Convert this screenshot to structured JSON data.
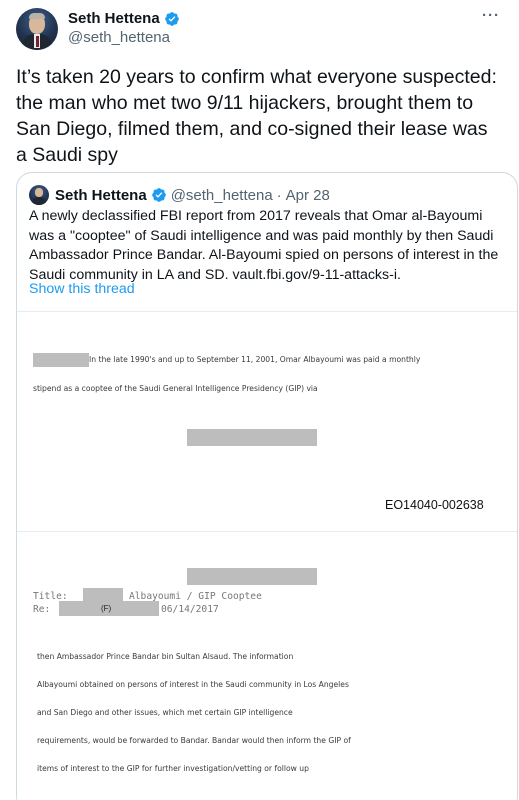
{
  "author": {
    "name": "Seth Hettena",
    "handle": "@seth_hettena"
  },
  "more_label": "···",
  "tweet_text": "It’s taken 20 years to confirm what everyone suspected: the man who met two 9/11 hijackers, brought them to San Diego, filmed them, and co-signed their lease was a Saudi spy",
  "quote": {
    "name": "Seth Hettena",
    "handle": "@seth_hettena",
    "dot": "·",
    "date": "Apr 28",
    "text": "A newly declassified FBI report from 2017 reveals that Omar al-Bayoumi was a \"cooptee\" of Saudi intelligence and was paid monthly by then Saudi Ambassador Prince Bandar. Al-Bayoumi spied on persons of interest in the Saudi community in LA and SD. vault.fbi.gov/9-11-attacks-i.",
    "thread_link": "Show this thread"
  },
  "document": {
    "page1": {
      "line1": "In the late 1990's and up to September 11, 2001, Omar Albayoumi was paid a monthly",
      "line2": "stipend as a cooptee of the Saudi General Intelligence Presidency (GIP) via",
      "doc_id": "EO14040-002638"
    },
    "page2": {
      "title_label": "Title:",
      "title_value": "Albayoumi / GIP Cooptee",
      "re_label": "Re:",
      "re_value": "06/14/2017",
      "f_label": "(F)",
      "lines": [
        "then Ambassador Prince Bandar bin Sultan Alsaud. The information",
        "Albayoumi obtained on persons of interest in the Saudi community in Los Angeles",
        "and San Diego and other issues, which met certain GIP intelligence",
        "requirements, would be forwarded to Bandar. Bandar would then inform the GIP of",
        "items of interest to the GIP for further investigation/vetting or follow up"
      ]
    }
  },
  "colors": {
    "verified": "#1d9bf0",
    "link": "#1d9bf0",
    "secondary_text": "#536471",
    "redaction": "#bdbdbd"
  },
  "icons": {
    "verified": "verified-badge-icon",
    "more": "more-horizontal-icon"
  }
}
